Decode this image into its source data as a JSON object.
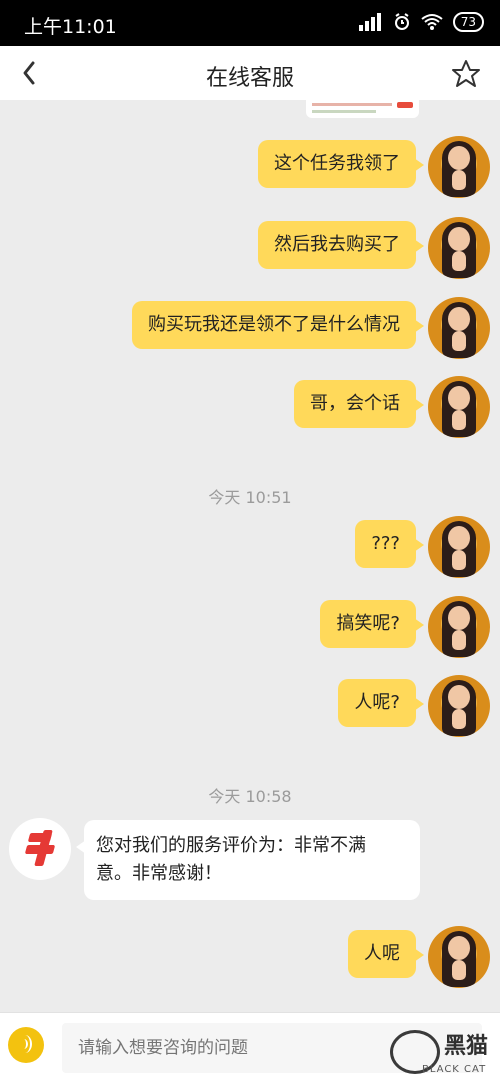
{
  "status_bar": {
    "time": "上午11:01",
    "battery": "73"
  },
  "header": {
    "title": "在线客服"
  },
  "messages": [
    {
      "text": "这个任务我领了"
    },
    {
      "text": "然后我去购买了"
    },
    {
      "text": "购买玩我还是领不了是什么情况"
    },
    {
      "text": "哥，会个话"
    },
    {
      "text": "???"
    },
    {
      "text": "搞笑呢?"
    },
    {
      "text": "人呢?"
    },
    {
      "text": "人呢"
    }
  ],
  "timestamps": [
    "今天 10:51",
    "今天 10:58"
  ],
  "agent_message": {
    "line1": "您对我们的服务评价为：非常不满",
    "line2": "意。非常感谢！"
  },
  "input": {
    "placeholder": "请输入想要咨询的问题"
  },
  "watermark": {
    "cn": "黑猫",
    "en": "BLACK CAT"
  }
}
